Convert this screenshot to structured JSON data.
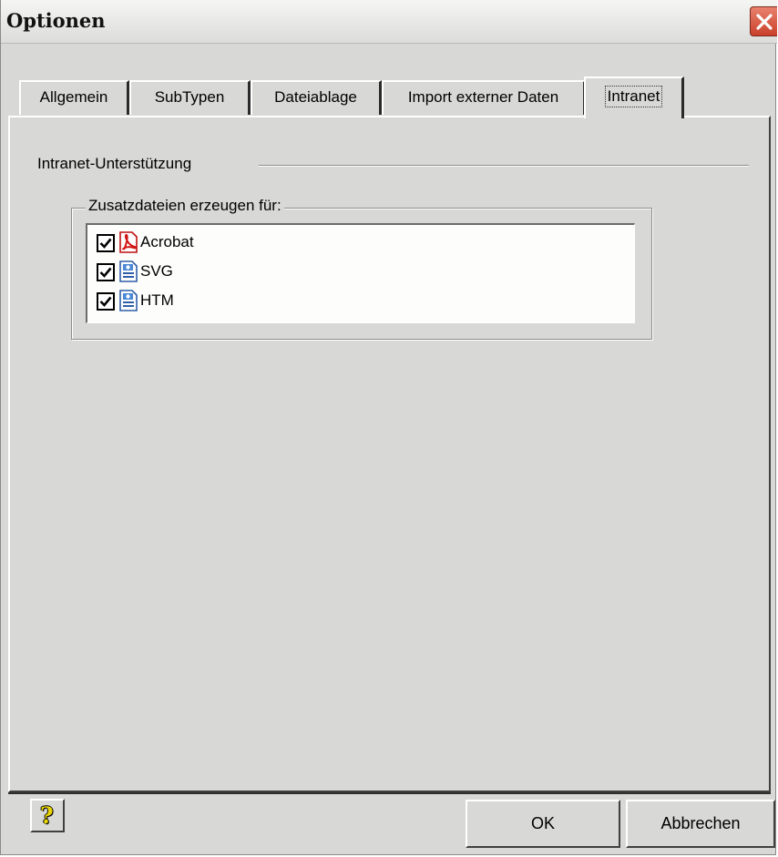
{
  "window": {
    "title": "Optionen"
  },
  "tabs": [
    {
      "label": "Allgemein",
      "active": false
    },
    {
      "label": "SubTypen",
      "active": false
    },
    {
      "label": "Dateiablage",
      "active": false
    },
    {
      "label": "Import externer Daten",
      "active": false
    },
    {
      "label": "Intranet",
      "active": true
    }
  ],
  "intranet": {
    "section_label": "Intranet-Unterstützung",
    "group_label": "Zusatzdateien erzeugen für:",
    "items": [
      {
        "label": "Acrobat",
        "checked": true,
        "icon": "pdf-file-icon"
      },
      {
        "label": "SVG",
        "checked": true,
        "icon": "web-document-icon"
      },
      {
        "label": "HTM",
        "checked": true,
        "icon": "web-document-icon"
      }
    ]
  },
  "buttons": {
    "help": "?",
    "ok": "OK",
    "cancel": "Abbrechen"
  }
}
